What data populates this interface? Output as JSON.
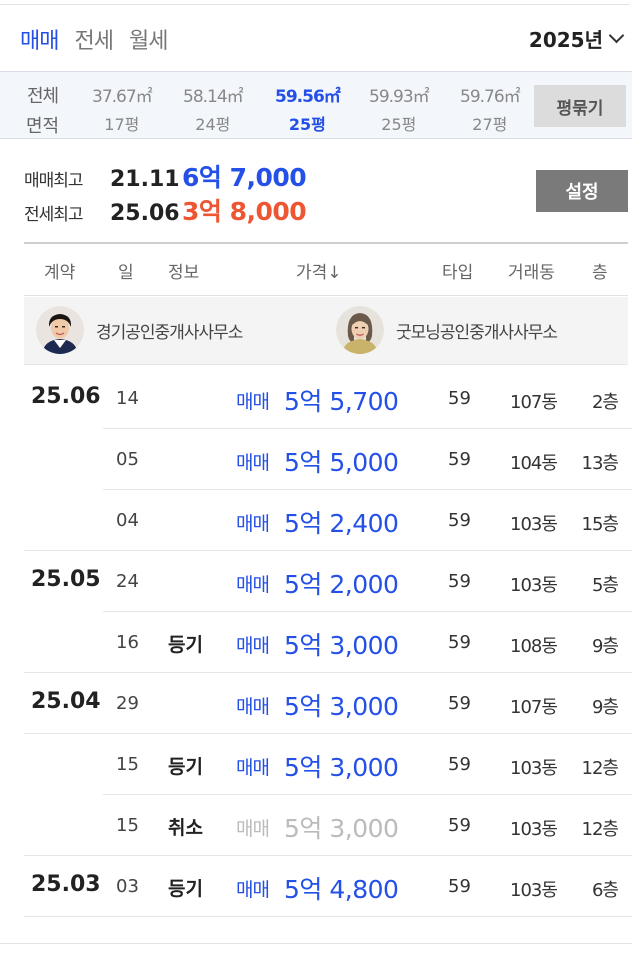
{
  "tabs": [
    {
      "label": "매매",
      "active": true
    },
    {
      "label": "전세",
      "active": false
    },
    {
      "label": "월세",
      "active": false
    }
  ],
  "year_selector": {
    "label": "2025년",
    "icon": "chevron-down-icon"
  },
  "areas": {
    "all": {
      "top": "전체",
      "bottom": "면적"
    },
    "items": [
      {
        "m2": "37.67㎡",
        "pyeong": "17평",
        "selected": false
      },
      {
        "m2": "58.14㎡",
        "pyeong": "24평",
        "selected": false
      },
      {
        "m2": "59.56㎡",
        "pyeong": "25평",
        "selected": true
      },
      {
        "m2": "59.93㎡",
        "pyeong": "25평",
        "selected": false
      },
      {
        "m2": "59.76㎡",
        "pyeong": "27평",
        "selected": false
      }
    ],
    "toggle_label": "평묶기"
  },
  "summary": {
    "sale_max": {
      "label": "매매최고",
      "date": "21.11",
      "price": "6억 7,000"
    },
    "jeonse_max": {
      "label": "전세최고",
      "date": "25.06",
      "price": "3억 8,000"
    },
    "setting_label": "설정"
  },
  "table_header": {
    "contract": "계약",
    "day": "일",
    "info": "정보",
    "price": "가격↓",
    "type": "타입",
    "dong": "거래동",
    "floor": "층"
  },
  "agents": [
    {
      "name": "경기공인중개사사무소"
    },
    {
      "name": "굿모닝공인중개사사무소"
    }
  ],
  "rows": [
    {
      "date": "25.06",
      "day": "14",
      "info": "",
      "kind": "매매",
      "amount": "5억 5,700",
      "type": "59",
      "dong": "107동",
      "floor": "2층",
      "cancelled": false
    },
    {
      "date": "",
      "day": "05",
      "info": "",
      "kind": "매매",
      "amount": "5억 5,000",
      "type": "59",
      "dong": "104동",
      "floor": "13층",
      "cancelled": false
    },
    {
      "date": "",
      "day": "04",
      "info": "",
      "kind": "매매",
      "amount": "5억 2,400",
      "type": "59",
      "dong": "103동",
      "floor": "15층",
      "cancelled": false
    },
    {
      "date": "25.05",
      "day": "24",
      "info": "",
      "kind": "매매",
      "amount": "5억 2,000",
      "type": "59",
      "dong": "103동",
      "floor": "5층",
      "cancelled": false
    },
    {
      "date": "",
      "day": "16",
      "info": "등기",
      "kind": "매매",
      "amount": "5억 3,000",
      "type": "59",
      "dong": "108동",
      "floor": "9층",
      "cancelled": false
    },
    {
      "date": "25.04",
      "day": "29",
      "info": "",
      "kind": "매매",
      "amount": "5억 3,000",
      "type": "59",
      "dong": "107동",
      "floor": "9층",
      "cancelled": false
    },
    {
      "date": "",
      "day": "15",
      "info": "등기",
      "kind": "매매",
      "amount": "5억 3,000",
      "type": "59",
      "dong": "103동",
      "floor": "12층",
      "cancelled": false
    },
    {
      "date": "",
      "day": "15",
      "info": "취소",
      "kind": "매매",
      "amount": "5억 3,000",
      "type": "59",
      "dong": "103동",
      "floor": "12층",
      "cancelled": true
    },
    {
      "date": "25.03",
      "day": "03",
      "info": "등기",
      "kind": "매매",
      "amount": "5억 4,800",
      "type": "59",
      "dong": "103동",
      "floor": "6층",
      "cancelled": false
    }
  ],
  "colors": {
    "accent_blue": "#2450e8",
    "jeonse_red": "#ee5533",
    "cancelled_gray": "#bbbbbb"
  }
}
